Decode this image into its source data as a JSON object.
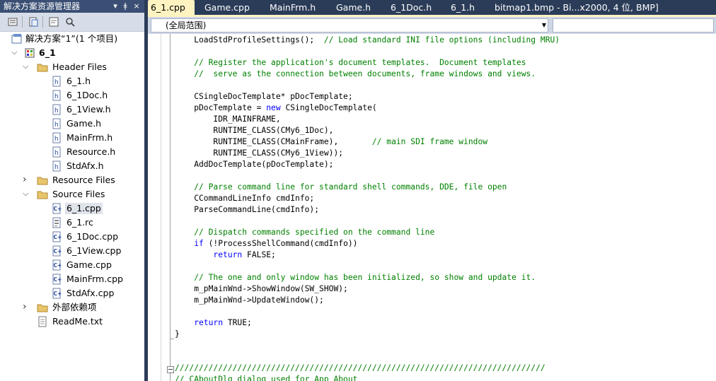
{
  "explorer": {
    "title": "解决方案资源管理器",
    "title_buttons": [
      "▾",
      "ǂ",
      "×"
    ],
    "toolbar_icons": [
      "properties-icon",
      "show-all-files-icon",
      "refresh-icon",
      "class-diagram-icon"
    ],
    "tree": [
      {
        "label": "解决方案“1”(1 个项目)",
        "icon": "solution-icon",
        "arrow": "",
        "level": 0
      },
      {
        "label": "6_1",
        "icon": "project-icon",
        "arrow": "◢",
        "level": 0,
        "bold": true
      },
      {
        "label": "Header Files",
        "icon": "folder-icon",
        "arrow": "◢",
        "level": 1
      },
      {
        "label": "6_1.h",
        "icon": "header-file-icon",
        "arrow": "",
        "level": 2
      },
      {
        "label": "6_1Doc.h",
        "icon": "header-file-icon",
        "arrow": "",
        "level": 2
      },
      {
        "label": "6_1View.h",
        "icon": "header-file-icon",
        "arrow": "",
        "level": 2
      },
      {
        "label": "Game.h",
        "icon": "header-file-icon",
        "arrow": "",
        "level": 2
      },
      {
        "label": "MainFrm.h",
        "icon": "header-file-icon",
        "arrow": "",
        "level": 2
      },
      {
        "label": "Resource.h",
        "icon": "header-file-icon",
        "arrow": "",
        "level": 2
      },
      {
        "label": "StdAfx.h",
        "icon": "header-file-icon",
        "arrow": "",
        "level": 2
      },
      {
        "label": "Resource Files",
        "icon": "folder-icon",
        "arrow": "▷",
        "level": 1
      },
      {
        "label": "Source Files",
        "icon": "folder-icon",
        "arrow": "◢",
        "level": 1
      },
      {
        "label": "6_1.cpp",
        "icon": "cpp-file-icon",
        "arrow": "",
        "level": 2,
        "selected": true
      },
      {
        "label": "6_1.rc",
        "icon": "rc-file-icon",
        "arrow": "",
        "level": 2
      },
      {
        "label": "6_1Doc.cpp",
        "icon": "cpp-file-icon",
        "arrow": "",
        "level": 2
      },
      {
        "label": "6_1View.cpp",
        "icon": "cpp-file-icon",
        "arrow": "",
        "level": 2
      },
      {
        "label": "Game.cpp",
        "icon": "cpp-file-icon",
        "arrow": "",
        "level": 2
      },
      {
        "label": "MainFrm.cpp",
        "icon": "cpp-file-icon",
        "arrow": "",
        "level": 2
      },
      {
        "label": "StdAfx.cpp",
        "icon": "cpp-file-icon",
        "arrow": "",
        "level": 2
      },
      {
        "label": "外部依赖项",
        "icon": "folder-icon",
        "arrow": "▷",
        "level": 1
      },
      {
        "label": "ReadMe.txt",
        "icon": "text-file-icon",
        "arrow": "",
        "level": 1
      }
    ]
  },
  "tabs": [
    {
      "label": "6_1.cpp",
      "active": true
    },
    {
      "label": "Game.cpp"
    },
    {
      "label": "MainFrm.h"
    },
    {
      "label": "Game.h"
    },
    {
      "label": "6_1Doc.h"
    },
    {
      "label": "6_1.h"
    },
    {
      "label": "bitmap1.bmp - Bi...x2000, 4 位, BMP]"
    }
  ],
  "navbar": {
    "scope": "(全局范围)"
  },
  "code_lines": [
    [
      {
        "t": "    LoadStdProfileSettings();  "
      },
      {
        "t": "// Load standard INI file options (including MRU)",
        "c": "cm"
      }
    ],
    [],
    [
      {
        "t": "    // Register the application's document templates.  Document templates",
        "c": "cm"
      }
    ],
    [
      {
        "t": "    //  serve as the connection between documents, frame windows and views.",
        "c": "cm"
      }
    ],
    [],
    [
      {
        "t": "    CSingleDocTemplate* pDocTemplate;"
      }
    ],
    [
      {
        "t": "    pDocTemplate = "
      },
      {
        "t": "new",
        "c": "kw"
      },
      {
        "t": " CSingleDocTemplate("
      }
    ],
    [
      {
        "t": "        IDR_MAINFRAME,"
      }
    ],
    [
      {
        "t": "        RUNTIME_CLASS(CMy6_1Doc),"
      }
    ],
    [
      {
        "t": "        RUNTIME_CLASS(CMainFrame),       "
      },
      {
        "t": "// main SDI frame window",
        "c": "cm"
      }
    ],
    [
      {
        "t": "        RUNTIME_CLASS(CMy6_1View));"
      }
    ],
    [
      {
        "t": "    AddDocTemplate(pDocTemplate);"
      }
    ],
    [],
    [
      {
        "t": "    // Parse command line for standard shell commands, DDE, file open",
        "c": "cm"
      }
    ],
    [
      {
        "t": "    CCommandLineInfo cmdInfo;"
      }
    ],
    [
      {
        "t": "    ParseCommandLine(cmdInfo);"
      }
    ],
    [],
    [
      {
        "t": "    // Dispatch commands specified on the command line",
        "c": "cm"
      }
    ],
    [
      {
        "t": "    "
      },
      {
        "t": "if",
        "c": "kw"
      },
      {
        "t": " (!ProcessShellCommand(cmdInfo))"
      }
    ],
    [
      {
        "t": "        "
      },
      {
        "t": "return",
        "c": "kw"
      },
      {
        "t": " FALSE;"
      }
    ],
    [],
    [
      {
        "t": "    // The one and only window has been initialized, so show and update it.",
        "c": "cm"
      }
    ],
    [
      {
        "t": "    m_pMainWnd->ShowWindow(SW_SHOW);"
      }
    ],
    [
      {
        "t": "    m_pMainWnd->UpdateWindow();"
      }
    ],
    [],
    [
      {
        "t": "    "
      },
      {
        "t": "return",
        "c": "kw"
      },
      {
        "t": " TRUE;"
      }
    ],
    [
      {
        "t": "}"
      }
    ],
    [],
    [],
    [
      {
        "t": "/////////////////////////////////////////////////////////////////////////////",
        "c": "cm"
      }
    ],
    [
      {
        "t": "// CAboutDlg dialog used for App About",
        "c": "cm"
      }
    ]
  ],
  "colors": {
    "title_bar": "#3a4f73",
    "tab_bar": "#2b3c59",
    "active_tab": "#fff3c2",
    "comment": "#008000",
    "keyword": "#0000ff"
  }
}
